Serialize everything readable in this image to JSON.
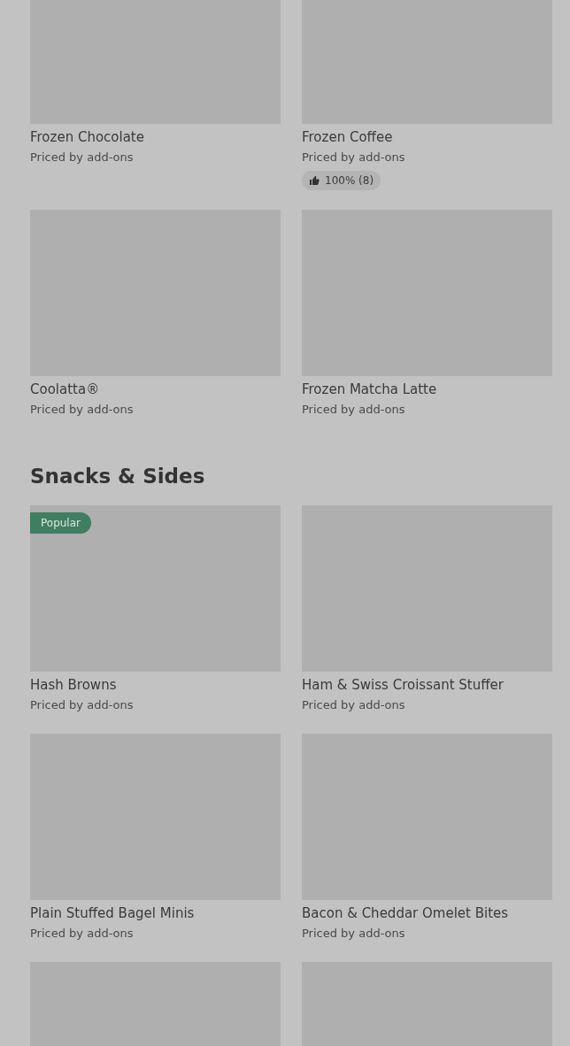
{
  "sections": [
    {
      "items": [
        {
          "kind": "item",
          "name": "Frozen Chocolate",
          "subtitle": "Priced by add-ons"
        },
        {
          "kind": "item",
          "name": "Frozen Coffee",
          "subtitle": "Priced by add-ons",
          "rating": "100% (8)"
        },
        {
          "kind": "item",
          "name": "Coolatta®",
          "subtitle": "Priced by add-ons"
        },
        {
          "kind": "item",
          "name": "Frozen Matcha Latte",
          "subtitle": "Priced by add-ons"
        }
      ]
    },
    {
      "title": "Snacks & Sides",
      "items": [
        {
          "kind": "item",
          "name": "Hash Browns",
          "subtitle": "Priced by add-ons",
          "badge": "Popular"
        },
        {
          "kind": "item",
          "name": "Ham & Swiss Croissant Stuffer",
          "subtitle": "Priced by add-ons"
        },
        {
          "kind": "item",
          "name": "Plain Stuffed Bagel Minis",
          "subtitle": "Priced by add-ons"
        },
        {
          "kind": "item",
          "name": "Bacon & Cheddar Omelet Bites",
          "subtitle": "Priced by add-ons"
        },
        {
          "kind": "image_only"
        },
        {
          "kind": "image_only"
        }
      ]
    }
  ]
}
